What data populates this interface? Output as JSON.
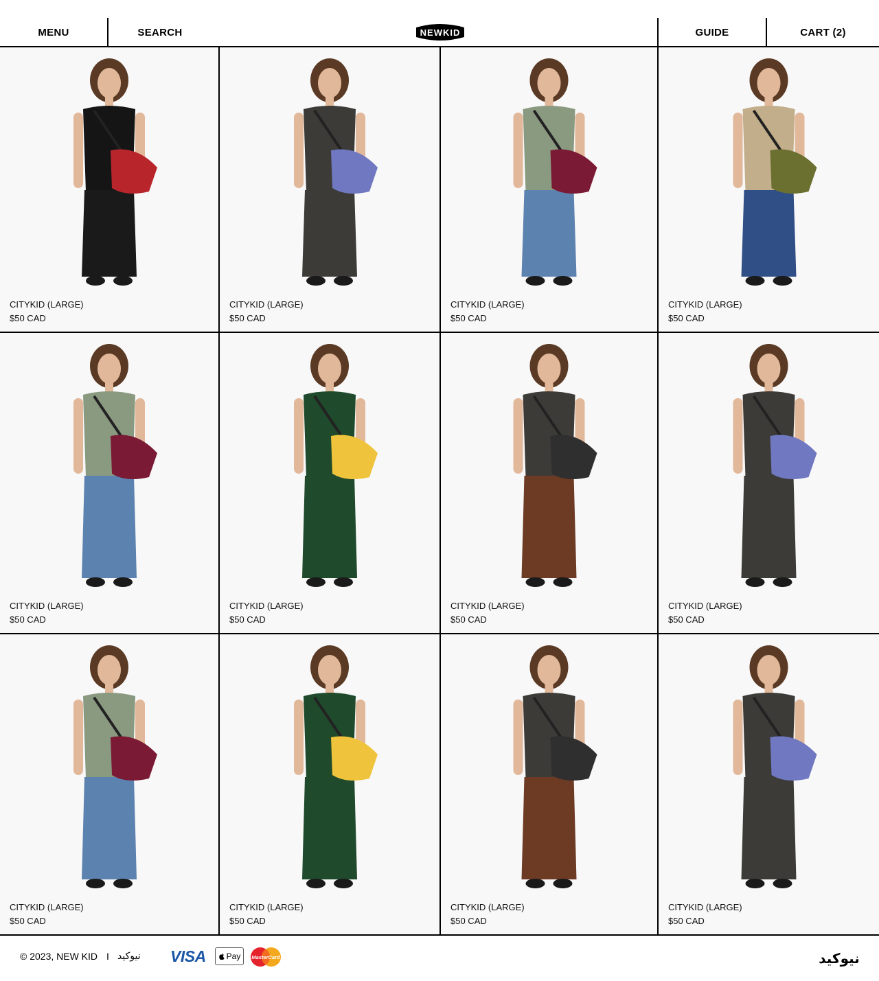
{
  "header": {
    "menu_label": "MENU",
    "search_label": "SEARCH",
    "logo_text": "NEWKID",
    "guide_label": "GUIDE",
    "cart_label": "CART (2)"
  },
  "products": [
    {
      "name": "CITYKID (LARGE)",
      "price": "$50 CAD",
      "bag_color": "#b8262c",
      "top_color": "#151515",
      "bottom_color": "#1a1a1a"
    },
    {
      "name": "CITYKID (LARGE)",
      "price": "$50 CAD",
      "bag_color": "#6f78c0",
      "top_color": "#3d3b38",
      "bottom_color": "#3d3b38"
    },
    {
      "name": "CITYKID (LARGE)",
      "price": "$50 CAD",
      "bag_color": "#7a1a35",
      "top_color": "#8a9a80",
      "bottom_color": "#5c82b0"
    },
    {
      "name": "CITYKID (LARGE)",
      "price": "$50 CAD",
      "bag_color": "#6b7030",
      "top_color": "#c2ae8a",
      "bottom_color": "#2f4f86"
    },
    {
      "name": "CITYKID (LARGE)",
      "price": "$50 CAD",
      "bag_color": "#7a1a35",
      "top_color": "#8a9a80",
      "bottom_color": "#5c82b0"
    },
    {
      "name": "CITYKID (LARGE)",
      "price": "$50 CAD",
      "bag_color": "#efc43c",
      "top_color": "#1f4a2c",
      "bottom_color": "#1f4a2c"
    },
    {
      "name": "CITYKID (LARGE)",
      "price": "$50 CAD",
      "bag_color": "#2f2f2f",
      "top_color": "#3d3b38",
      "bottom_color": "#6d3a24"
    },
    {
      "name": "CITYKID (LARGE)",
      "price": "$50 CAD",
      "bag_color": "#6f78c0",
      "top_color": "#3d3b38",
      "bottom_color": "#3d3b38"
    },
    {
      "name": "CITYKID (LARGE)",
      "price": "$50 CAD",
      "bag_color": "#7a1a35",
      "top_color": "#8a9a80",
      "bottom_color": "#5c82b0"
    },
    {
      "name": "CITYKID (LARGE)",
      "price": "$50 CAD",
      "bag_color": "#efc43c",
      "top_color": "#1f4a2c",
      "bottom_color": "#1f4a2c"
    },
    {
      "name": "CITYKID (LARGE)",
      "price": "$50 CAD",
      "bag_color": "#2f2f2f",
      "top_color": "#3d3b38",
      "bottom_color": "#6d3a24"
    },
    {
      "name": "CITYKID (LARGE)",
      "price": "$50 CAD",
      "bag_color": "#6f78c0",
      "top_color": "#3d3b38",
      "bottom_color": "#3d3b38"
    }
  ],
  "footer": {
    "copyright": "© 2023, NEW KID",
    "separator": "I",
    "arabic_name": "نيوكيد",
    "payment_visa": "VISA",
    "payment_applepay": "Pay",
    "payment_mastercard": "MasterCard",
    "logo_text": "نيوكيد"
  }
}
